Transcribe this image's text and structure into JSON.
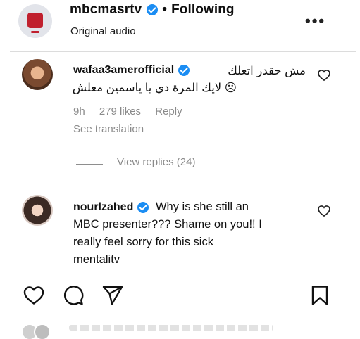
{
  "header": {
    "account": "mbcmasrtv",
    "separator": "•",
    "following": "Following",
    "audio": "Original audio",
    "more_icon": "more-icon"
  },
  "comments": [
    {
      "username": "wafaa3amerofficial",
      "text_line1": "مش حقدر اتعلك",
      "text_line2": "☹ لايك المرة دي يا ياسمين معلش",
      "time": "9h",
      "likes": "279 likes",
      "reply": "Reply",
      "translation": "See translation",
      "view_replies": "View replies (24)"
    },
    {
      "username": "nourlzahed",
      "text_line1": "Why is she still an",
      "text_line2": "MBC presenter??? Shame on you!! I",
      "text_line3": "really feel sorry for this sick",
      "text_line4": "mentality"
    }
  ],
  "actions": {
    "like_icon": "heart-icon",
    "comment_icon": "comment-icon",
    "share_icon": "send-icon",
    "save_icon": "bookmark-icon"
  },
  "colors": {
    "verified": "#1b8df3",
    "muted": "#8a8a8a",
    "text": "#0f0f0f",
    "brand_red": "#c0202e"
  }
}
